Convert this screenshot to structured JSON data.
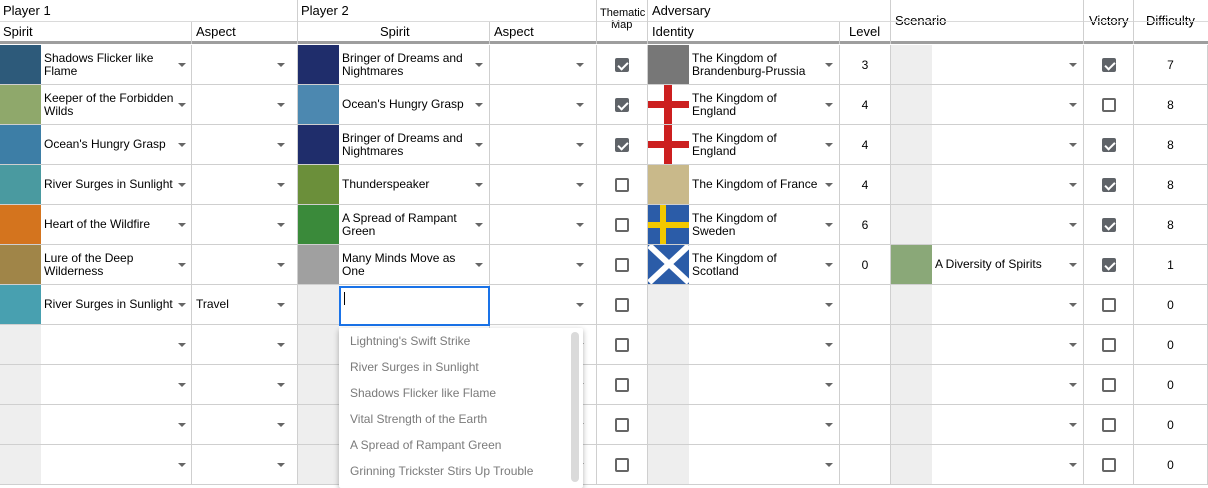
{
  "headers": {
    "player1": "Player 1",
    "player2": "Player 2",
    "spirit": "Spirit",
    "aspect": "Aspect",
    "thematic_map_line1": "Thematic",
    "thematic_map_line2": "Map",
    "adversary": "Adversary",
    "identity": "Identity",
    "level": "Level",
    "scenario": "Scenario",
    "victory": "Victory",
    "difficulty": "Difficulty"
  },
  "rows": [
    {
      "p1_spirit": "Shadows Flicker like Flame",
      "p1_aspect": "",
      "p2_spirit": "Bringer of Dreams and Nightmares",
      "p2_aspect": "",
      "thematic": true,
      "adversary": "The Kingdom of Brandenburg-Prussia",
      "level": "3",
      "scenario": "",
      "victory": true,
      "difficulty": "7"
    },
    {
      "p1_spirit": "Keeper of the Forbidden Wilds",
      "p1_aspect": "",
      "p2_spirit": "Ocean's Hungry Grasp",
      "p2_aspect": "",
      "thematic": true,
      "adversary": "The Kingdom of England",
      "level": "4",
      "scenario": "",
      "victory": false,
      "difficulty": "8"
    },
    {
      "p1_spirit": "Ocean's Hungry Grasp",
      "p1_aspect": "",
      "p2_spirit": "Bringer of Dreams and Nightmares",
      "p2_aspect": "",
      "thematic": true,
      "adversary": "The Kingdom of England",
      "level": "4",
      "scenario": "",
      "victory": true,
      "difficulty": "8"
    },
    {
      "p1_spirit": "River Surges in Sunlight",
      "p1_aspect": "",
      "p2_spirit": "Thunderspeaker",
      "p2_aspect": "",
      "thematic": false,
      "adversary": "The Kingdom of France",
      "level": "4",
      "scenario": "",
      "victory": true,
      "difficulty": "8"
    },
    {
      "p1_spirit": "Heart of the Wildfire",
      "p1_aspect": "",
      "p2_spirit": "A Spread of Rampant Green",
      "p2_aspect": "",
      "thematic": false,
      "adversary": "The Kingdom of Sweden",
      "level": "6",
      "scenario": "",
      "victory": true,
      "difficulty": "8"
    },
    {
      "p1_spirit": "Lure of the Deep Wilderness",
      "p1_aspect": "",
      "p2_spirit": "Many Minds Move as One",
      "p2_aspect": "",
      "thematic": false,
      "adversary": "The Kingdom of Scotland",
      "level": "0",
      "scenario": "A Diversity of Spirits",
      "victory": true,
      "difficulty": "1"
    },
    {
      "p1_spirit": "River Surges in Sunlight",
      "p1_aspect": "Travel",
      "p2_spirit": "",
      "p2_aspect": "",
      "thematic": false,
      "adversary": "",
      "level": "",
      "scenario": "",
      "victory": false,
      "difficulty": "0"
    },
    {
      "p1_spirit": "",
      "p1_aspect": "",
      "p2_spirit": "",
      "p2_aspect": "",
      "thematic": false,
      "adversary": "",
      "level": "",
      "scenario": "",
      "victory": false,
      "difficulty": "0"
    },
    {
      "p1_spirit": "",
      "p1_aspect": "",
      "p2_spirit": "",
      "p2_aspect": "",
      "thematic": false,
      "adversary": "",
      "level": "",
      "scenario": "",
      "victory": false,
      "difficulty": "0"
    },
    {
      "p1_spirit": "",
      "p1_aspect": "",
      "p2_spirit": "",
      "p2_aspect": "",
      "thematic": false,
      "adversary": "",
      "level": "",
      "scenario": "",
      "victory": false,
      "difficulty": "0"
    },
    {
      "p1_spirit": "",
      "p1_aspect": "",
      "p2_spirit": "",
      "p2_aspect": "",
      "thematic": false,
      "adversary": "",
      "level": "",
      "scenario": "",
      "victory": false,
      "difficulty": "0"
    }
  ],
  "dropdown": {
    "options": [
      "Lightning's Swift Strike",
      "River Surges in Sunlight",
      "Shadows Flicker like Flame",
      "Vital Strength of the Earth",
      "A Spread of Rampant Green",
      "Grinning Trickster Stirs Up Trouble"
    ]
  },
  "colors": {
    "grid": "#cfcfcf",
    "header_rule": "#9e9e9e",
    "checkbox_checked": "#5f6368",
    "editor_border": "#1a73e8"
  }
}
